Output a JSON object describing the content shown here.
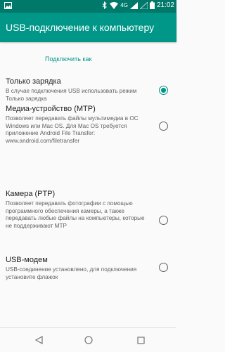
{
  "status_bar": {
    "network_label": "4G",
    "time": "21:02",
    "icons": [
      "notification-image-icon",
      "bluetooth-icon",
      "wifi-icon",
      "signal-icon",
      "battery-icon"
    ]
  },
  "app_bar": {
    "title": "USB-подключение к компьютеру"
  },
  "section": {
    "header": "Подключить как"
  },
  "options": [
    {
      "title": "Только зарядка",
      "description": "В случае подключения USB использовать режим Только зарядка",
      "selected": true
    },
    {
      "title": "Медиа-устройство (MTP)",
      "description": "Позволяет передавать файлы мультимедиа в ОС Windows или Mac OS. Для Mac OS требуется приложение Android File Transfer: www.android.com/filetransfer",
      "selected": false
    },
    {
      "title": "Камера (PTP)",
      "description": "Позволяет передавать фотографии с помощью программного обеспечения камеры, а также передавать любые файлы на компьютеры, которые не поддерживают MTP",
      "selected": false
    },
    {
      "title": "USB-модем",
      "description": "USB-соединение установлено, для подключения установите флажок",
      "selected": false
    }
  ],
  "colors": {
    "accent": "#009688",
    "status_bar": "#00796b"
  },
  "nav_bar": {
    "icons": [
      "back-icon",
      "home-icon",
      "recents-icon"
    ]
  }
}
